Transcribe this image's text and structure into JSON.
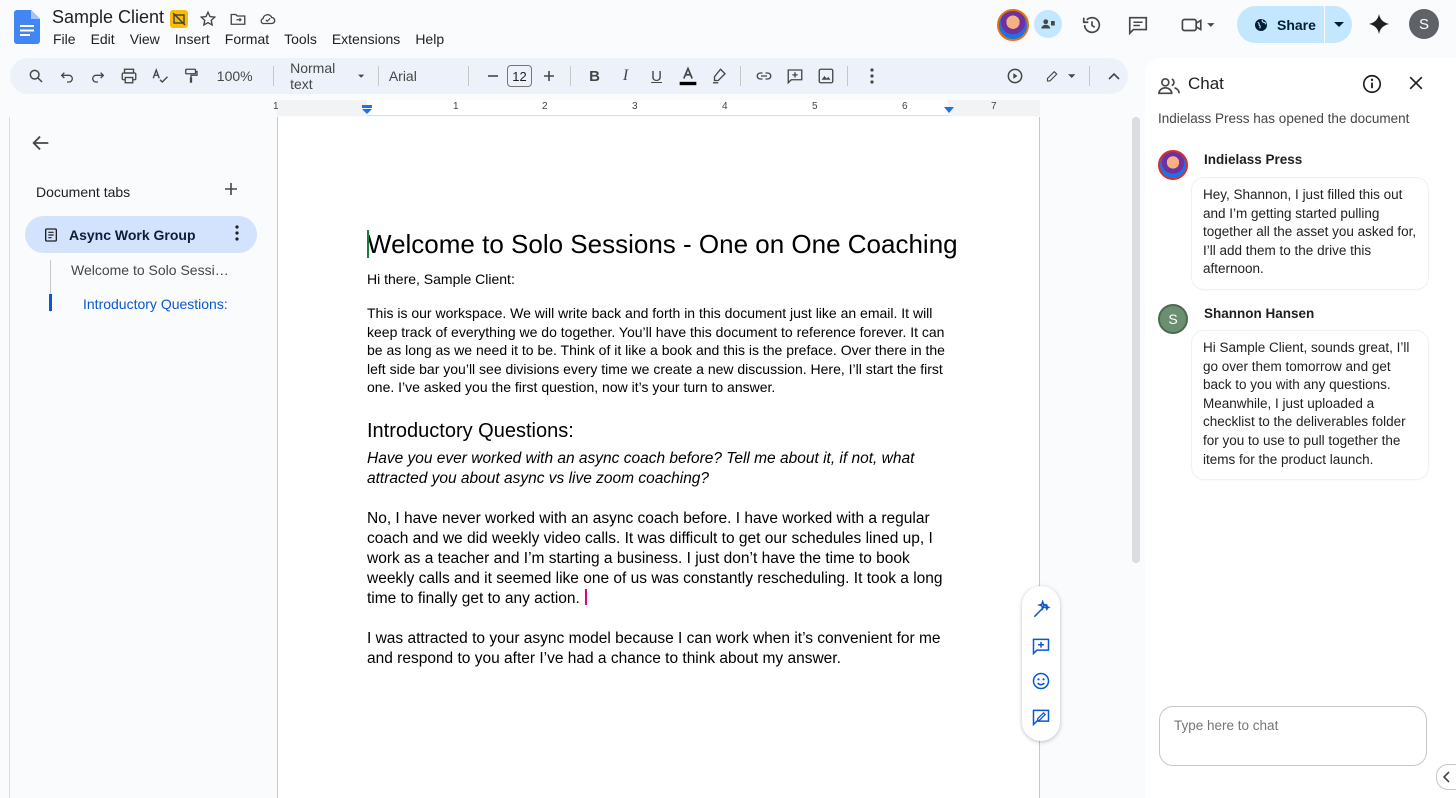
{
  "doc": {
    "title": "Sample Client"
  },
  "menu": [
    "File",
    "Edit",
    "View",
    "Insert",
    "Format",
    "Tools",
    "Extensions",
    "Help"
  ],
  "header": {
    "share_label": "Share",
    "user_initial": "S"
  },
  "toolbar": {
    "zoom": "100%",
    "style": "Normal text",
    "font": "Arial",
    "font_size": "12"
  },
  "ruler": {
    "labels": [
      "1",
      "1",
      "2",
      "3",
      "4",
      "5",
      "6",
      "7"
    ]
  },
  "tabs": {
    "header": "Document tabs",
    "active_tab": "Async Work Group",
    "sub_items": [
      "Welcome to Solo Session…",
      "Introductory Questions:"
    ]
  },
  "document": {
    "heading": "Welcome to Solo Sessions - One on One Coaching",
    "greeting": "Hi there, Sample Client:",
    "intro_paragraph": "This is our workspace. We will write back and forth in this document just like an email. It will keep track of everything we do together. You’ll have this document to reference forever. It can be as long as we need it to be. Think of it like a book and this is the preface. Over there in the left side bar you’ll see divisions every time we create a new discussion. Here, I’ll start the first one. I’ve asked you the first question, now it’s your turn to answer.",
    "section_heading": "Introductory Questions:",
    "question": "Have you ever worked with an async coach before? Tell me about it, if not, what attracted you about async vs live zoom coaching?",
    "answer_1": "No, I have never worked with an async coach before. I have worked with a regular coach and we did weekly video calls. It was difficult to get our schedules lined up, I work as a teacher and I’m starting a business. I just don’t have the time to book weekly calls and it seemed like one of us was constantly rescheduling. It took a long time to finally get to any action.",
    "answer_2": "I was attracted to your async model because I can work when it’s convenient for me and respond to you after I’ve had a chance to think about my answer."
  },
  "chat": {
    "title": "Chat",
    "opened_notice": "Indielass Press has opened the document",
    "messages": [
      {
        "author": "Indielass Press",
        "text": "Hey, Shannon, I just filled this out and I’m getting started pulling together all the asset you asked for, I’ll add them to the drive this afternoon."
      },
      {
        "author": "Shannon Hansen",
        "avatar_initial": "S",
        "text": "Hi Sample Client, sounds great, I’ll go over them tomorrow and get back to you with any questions. Meanwhile, I just uploaded a checklist to the deliverables folder for you to use to pull together the items for the product launch."
      }
    ],
    "input_placeholder": "Type here to chat"
  },
  "colors": {
    "accent": "#0b57d0",
    "share_bg": "#c2e7ff",
    "tab_active_bg": "#d3e3fd",
    "toolbar_bg": "#edf2fa"
  }
}
